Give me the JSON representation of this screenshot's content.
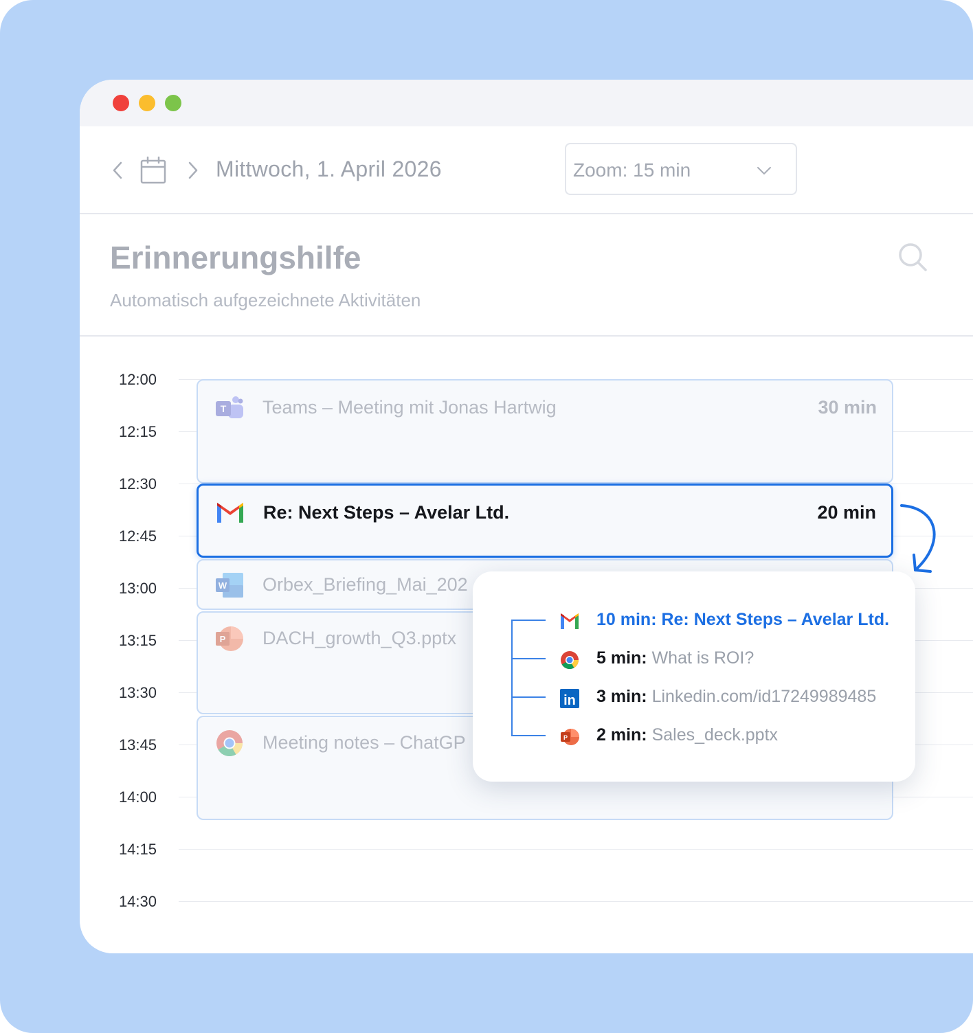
{
  "toolbar": {
    "date": "Mittwoch, 1. April 2026",
    "zoom_label": "Zoom: 15 min"
  },
  "header": {
    "title": "Erinnerungshilfe",
    "subtitle": "Automatisch aufgezeichnete Aktivitäten"
  },
  "timeline": {
    "times": [
      "12:00",
      "12:15",
      "12:30",
      "12:45",
      "13:00",
      "13:15",
      "13:30",
      "13:45",
      "14:00",
      "14:15",
      "14:30"
    ],
    "events": [
      {
        "app": "teams-icon",
        "title": "Teams – Meeting mit Jonas Hartwig",
        "duration": "30 min"
      },
      {
        "app": "gmail-icon",
        "title": "Re: Next Steps – Avelar Ltd.",
        "duration": "20 min",
        "active": true
      },
      {
        "app": "word-icon",
        "title": "Orbex_Briefing_Mai_202"
      },
      {
        "app": "powerpoint-icon",
        "title": "DACH_growth_Q3.pptx"
      },
      {
        "app": "chrome-icon",
        "title": "Meeting notes – ChatGP"
      }
    ]
  },
  "popup": {
    "items": [
      {
        "icon": "gmail-icon",
        "text": "10 min: Re: Next Steps – Avelar Ltd."
      },
      {
        "icon": "chrome-icon",
        "duration": "5 min:",
        "value": "What is ROI?"
      },
      {
        "icon": "linkedin-icon",
        "duration": "3 min:",
        "value": "Linkedin.com/id17249989485"
      },
      {
        "icon": "powerpoint-icon",
        "duration": "2 min:",
        "value": "Sales_deck.pptx"
      }
    ]
  },
  "colors": {
    "background": "#b6d3f8",
    "accent": "#1c6fe3",
    "dot_red": "#f0413c",
    "dot_yellow": "#fbbd2e",
    "dot_green": "#7cc44a"
  }
}
